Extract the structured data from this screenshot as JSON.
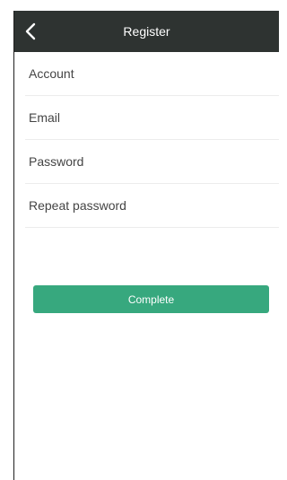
{
  "header": {
    "title": "Register",
    "back_icon": "chevron-left-icon"
  },
  "form": {
    "fields": [
      {
        "placeholder": "Account",
        "value": ""
      },
      {
        "placeholder": "Email",
        "value": ""
      },
      {
        "placeholder": "Password",
        "value": ""
      },
      {
        "placeholder": "Repeat password",
        "value": ""
      }
    ]
  },
  "actions": {
    "complete_label": "Complete"
  },
  "colors": {
    "navbar": "#2e3331",
    "accent": "#37a87e",
    "divider": "#ececec"
  }
}
